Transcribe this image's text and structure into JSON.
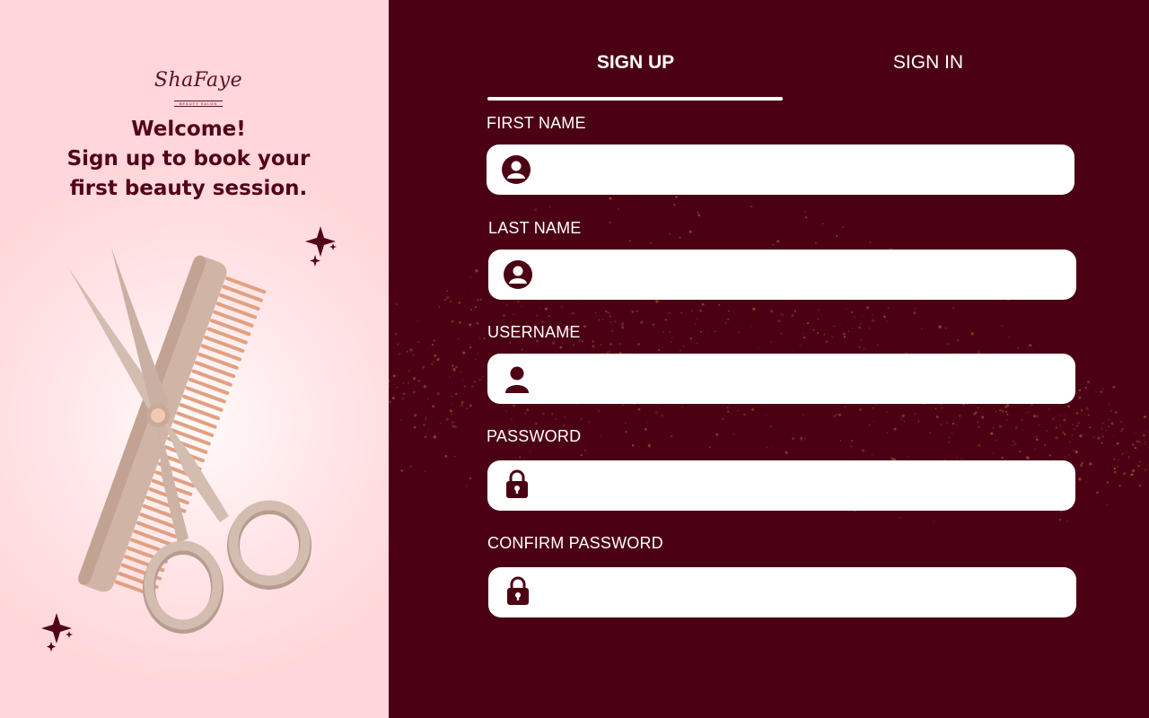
{
  "brand": {
    "logo_text": "ShaFaye",
    "logo_subtitle": "BEAUTY SALON"
  },
  "welcome": {
    "line1": "Welcome!",
    "line2": "Sign up to book your",
    "line3": "first beauty session."
  },
  "tabs": {
    "signup": "SIGN UP",
    "signin": "SIGN IN",
    "active": "signup"
  },
  "form": {
    "fields": [
      {
        "label": "FIRST NAME",
        "value": "",
        "icon": "user-circle-icon"
      },
      {
        "label": "LAST NAME",
        "value": "",
        "icon": "user-circle-icon"
      },
      {
        "label": "USERNAME",
        "value": "",
        "icon": "user-icon"
      },
      {
        "label": "PASSWORD",
        "value": "",
        "icon": "lock-icon"
      },
      {
        "label": "CONFIRM PASSWORD",
        "value": "",
        "icon": "lock-icon"
      }
    ]
  },
  "colors": {
    "left_bg": "#ffd6d9",
    "right_bg": "#4c0014",
    "brand_dark": "#520019",
    "field_bg": "#ffffff",
    "glitter": "#a0502e"
  }
}
